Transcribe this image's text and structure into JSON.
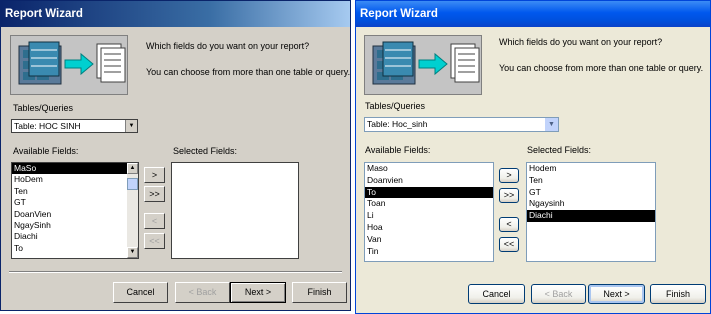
{
  "left": {
    "title": "Report Wizard",
    "question": "Which fields do you want on your report?",
    "hint": "You can choose from more than one table or query.",
    "tables_label": "Tables/Queries",
    "table_value": "Table: HOC SINH",
    "available_label": "Available Fields:",
    "selected_label": "Selected Fields:",
    "available_fields": [
      "MaSo",
      "HoDem",
      "Ten",
      "GT",
      "DoanVien",
      "NgaySinh",
      "Diachi",
      "To"
    ],
    "selected_index": 0,
    "selected_fields": [],
    "buttons": {
      "add": ">",
      "add_all": ">>",
      "remove": "<",
      "remove_all": "<<",
      "cancel": "Cancel",
      "back": "< Back",
      "next": "Next >",
      "finish": "Finish"
    }
  },
  "right": {
    "title": "Report Wizard",
    "question": "Which fields do you want on your report?",
    "hint": "You can choose from more than one table or query.",
    "tables_label": "Tables/Queries",
    "table_value": "Table: Hoc_sinh",
    "available_label": "Available Fields:",
    "selected_label": "Selected Fields:",
    "available_fields": [
      "Maso",
      "Doanvien",
      "To",
      "Toan",
      "Li",
      "Hoa",
      "Van",
      "Tin"
    ],
    "available_selected_index": 2,
    "selected_fields": [
      "Hodem",
      "Ten",
      "GT",
      "Ngaysinh",
      "Diachi"
    ],
    "selected_selected_index": 4,
    "buttons": {
      "add": ">",
      "add_all": ">>",
      "remove": "<",
      "remove_all": "<<",
      "cancel": "Cancel",
      "back": "< Back",
      "next": "Next >",
      "finish": "Finish"
    }
  },
  "icons": {
    "dropdown": "chevron-down-icon",
    "scroll_up": "arrow-up-icon",
    "scroll_down": "arrow-down-icon",
    "wizard": "report-wizard-illustration-icon"
  },
  "colors": {
    "classic_title": "#0a246a",
    "xp_title": "#0058ee",
    "selection": "#000000"
  }
}
